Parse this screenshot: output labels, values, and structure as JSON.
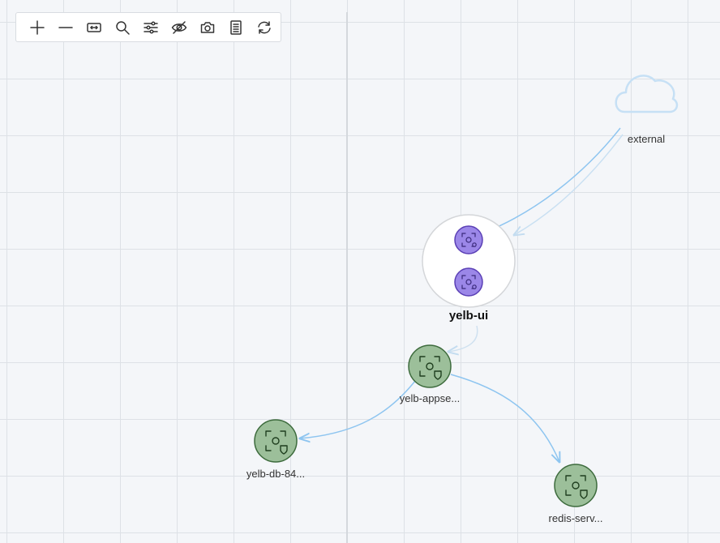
{
  "toolbar": {
    "buttons": [
      {
        "id": "zoom-in",
        "icon": "plus-icon"
      },
      {
        "id": "zoom-out",
        "icon": "minus-icon"
      },
      {
        "id": "fit",
        "icon": "fit-to-screen-icon"
      },
      {
        "id": "search",
        "icon": "search-icon"
      },
      {
        "id": "filter",
        "icon": "sliders-icon"
      },
      {
        "id": "hide",
        "icon": "eye-slash-icon"
      },
      {
        "id": "snapshot",
        "icon": "camera-icon"
      },
      {
        "id": "details",
        "icon": "list-icon"
      },
      {
        "id": "refresh",
        "icon": "refresh-icon"
      }
    ]
  },
  "graph": {
    "external": {
      "label": "external",
      "icon": "cloud-icon",
      "color": "#c6e0f5"
    },
    "group": {
      "label": "yelb-ui",
      "pods": 2,
      "pod_color": "#9b87e8",
      "pod_stroke": "#5a3fb5"
    },
    "nodes": [
      {
        "id": "appserver",
        "label": "yelb-appse...",
        "color": "#9cbf9a",
        "stroke": "#3d6b3d"
      },
      {
        "id": "db",
        "label": "yelb-db-84...",
        "color": "#9cbf9a",
        "stroke": "#3d6b3d"
      },
      {
        "id": "redis",
        "label": "redis-serv...",
        "color": "#9cbf9a",
        "stroke": "#3d6b3d"
      }
    ],
    "edge_color": "#8ec5f0"
  }
}
